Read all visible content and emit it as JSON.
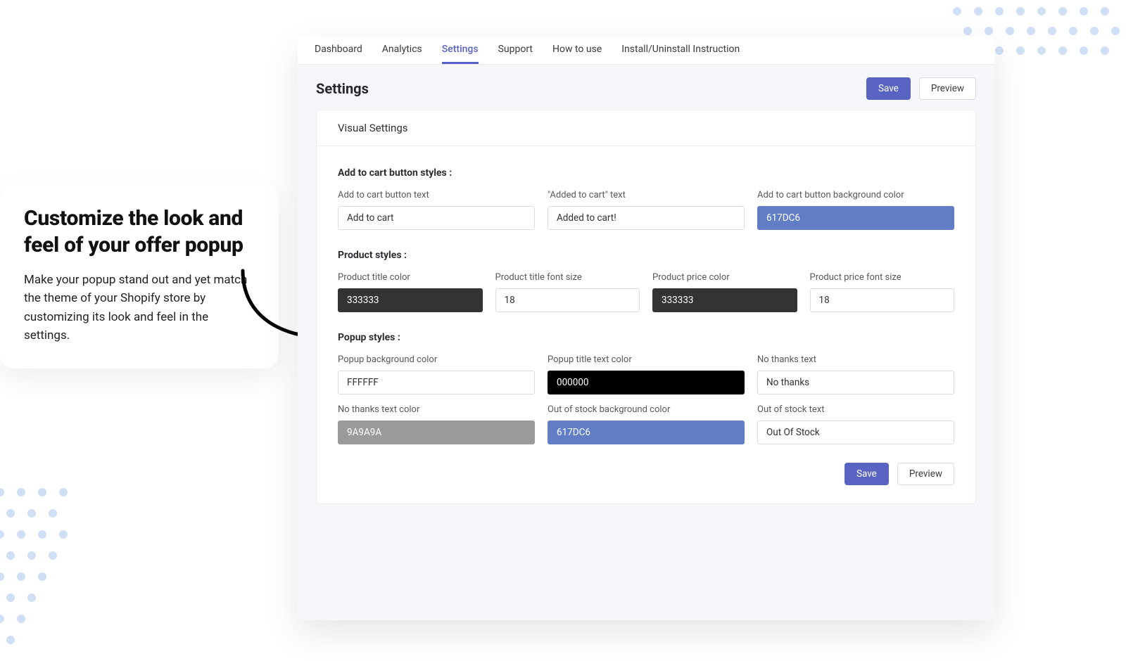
{
  "promo": {
    "title": "Customize the look and feel of your offer popup",
    "text": "Make your popup stand out and yet match the theme of your Shopify store by customizing its look and feel in the settings."
  },
  "tabs": [
    "Dashboard",
    "Analytics",
    "Settings",
    "Support",
    "How to use",
    "Install/Uninstall Instruction"
  ],
  "active_tab": "Settings",
  "page_title": "Settings",
  "buttons": {
    "save": "Save",
    "preview": "Preview"
  },
  "visual_settings_title": "Visual Settings",
  "sections": {
    "add_to_cart": {
      "heading": "Add to cart button styles :",
      "fields": {
        "button_text": {
          "label": "Add to cart button text",
          "value": "Add to cart"
        },
        "added_text": {
          "label": "\"Added to cart\" text",
          "value": "Added to cart!"
        },
        "bg_color": {
          "label": "Add to cart button background color",
          "value": "617DC6"
        }
      }
    },
    "product": {
      "heading": "Product styles :",
      "fields": {
        "title_color": {
          "label": "Product title color",
          "value": "333333"
        },
        "title_font_size": {
          "label": "Product title font size",
          "value": "18"
        },
        "price_color": {
          "label": "Product price color",
          "value": "333333"
        },
        "price_font_size": {
          "label": "Product price font size",
          "value": "18"
        }
      }
    },
    "popup": {
      "heading": "Popup styles :",
      "fields": {
        "bg_color": {
          "label": "Popup background color",
          "value": "FFFFFF"
        },
        "title_color": {
          "label": "Popup title text color",
          "value": "000000"
        },
        "no_thanks_text": {
          "label": "No thanks text",
          "value": "No thanks"
        },
        "no_thanks_color": {
          "label": "No thanks text color",
          "value": "9A9A9A"
        },
        "oos_bg_color": {
          "label": "Out of stock background color",
          "value": "617DC6"
        },
        "oos_text": {
          "label": "Out of stock text",
          "value": "Out Of Stock"
        }
      }
    }
  }
}
